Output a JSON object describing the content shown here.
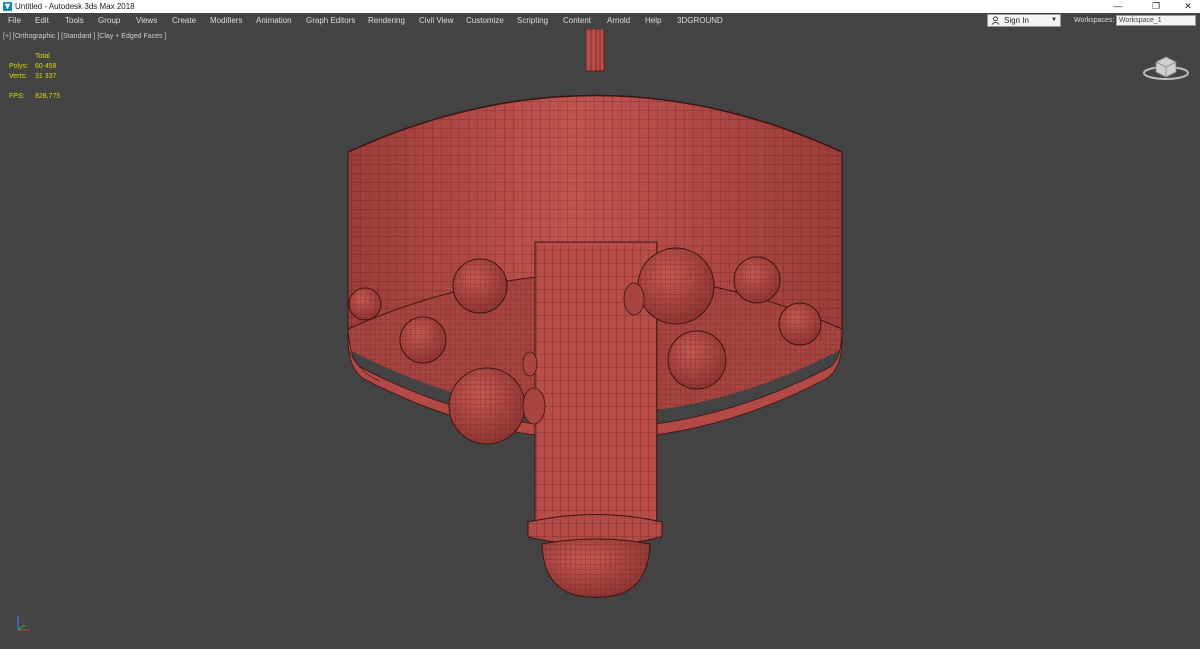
{
  "window": {
    "title": "Untitled - Autodesk 3ds Max 2018",
    "minimize_glyph": "—",
    "maximize_glyph": "❐",
    "close_glyph": "✕"
  },
  "menu": [
    "File",
    "Edit",
    "Tools",
    "Group",
    "Views",
    "Create",
    "Modifiers",
    "Animation",
    "Graph Editors",
    "Rendering",
    "Civil View",
    "Customize",
    "Scripting",
    "Content",
    "Arnold",
    "Help",
    "3DGROUND"
  ],
  "account": {
    "sign_in_label": "Sign In",
    "dropdown_glyph": "▼"
  },
  "workspaces": {
    "label": "Workspaces:",
    "current": "Workspace_1"
  },
  "viewport": {
    "label": "[+] [Orthographic ] [Standard ] [Clay + Edged Faces ]",
    "stats": {
      "total_label": "Total",
      "polys_label": "Polys:",
      "polys_value": "60 458",
      "verts_label": "Verts:",
      "verts_value": "31 337",
      "fps_label": "FPS:",
      "fps_value": "828,775"
    }
  },
  "colors": {
    "model": "#b94d48",
    "wire": "#3a1513",
    "viewport_bg": "#444444",
    "stats_text": "#d9d900"
  },
  "icons": {
    "app": "3dsmax-app-icon",
    "user": "user-icon",
    "viewcube": "viewcube-icon",
    "axis": "axis-tripod-icon"
  }
}
